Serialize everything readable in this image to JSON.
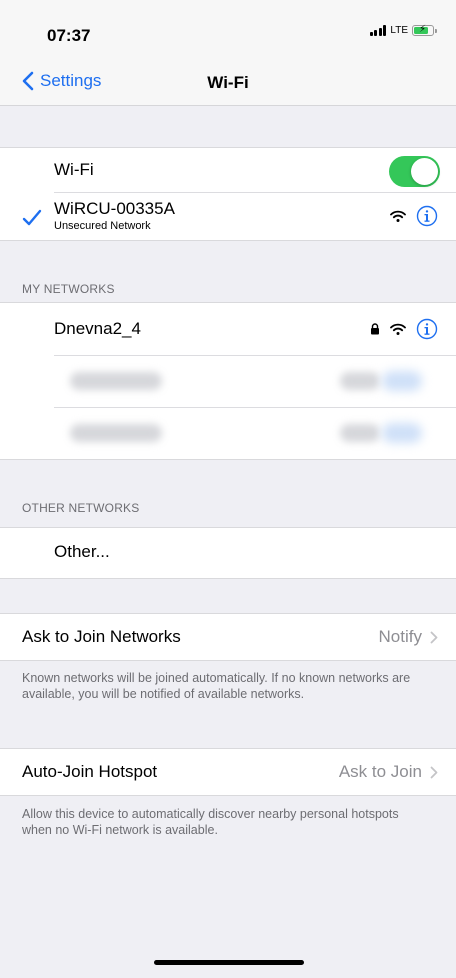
{
  "status_bar": {
    "time": "07:37",
    "network": "LTE",
    "signal_icon": "cellular-signal-icon",
    "battery_icon": "battery-charging-icon"
  },
  "nav": {
    "back_label": "Settings",
    "title": "Wi-Fi"
  },
  "wifi_toggle": {
    "label": "Wi-Fi",
    "state": "on"
  },
  "connected_network": {
    "name": "WiRCU-00335A",
    "subtitle": "Unsecured Network"
  },
  "my_networks": {
    "header": "MY NETWORKS",
    "items": [
      {
        "name": "Dnevna2_4",
        "secured": true
      }
    ]
  },
  "other_networks": {
    "header": "OTHER NETWORKS",
    "other_label": "Other..."
  },
  "ask_to_join": {
    "label": "Ask to Join Networks",
    "value": "Notify",
    "note": "Known networks will be joined automatically. If no known networks are available, you will be notified of available networks."
  },
  "auto_join_hotspot": {
    "label": "Auto-Join Hotspot",
    "value": "Ask to Join",
    "note": "Allow this device to automatically discover nearby personal hotspots when no Wi-Fi network is available."
  },
  "colors": {
    "accent": "#1e6ff0",
    "toggle_on": "#34c759",
    "background": "#efeff4",
    "secondary_text": "#8e8e93"
  }
}
